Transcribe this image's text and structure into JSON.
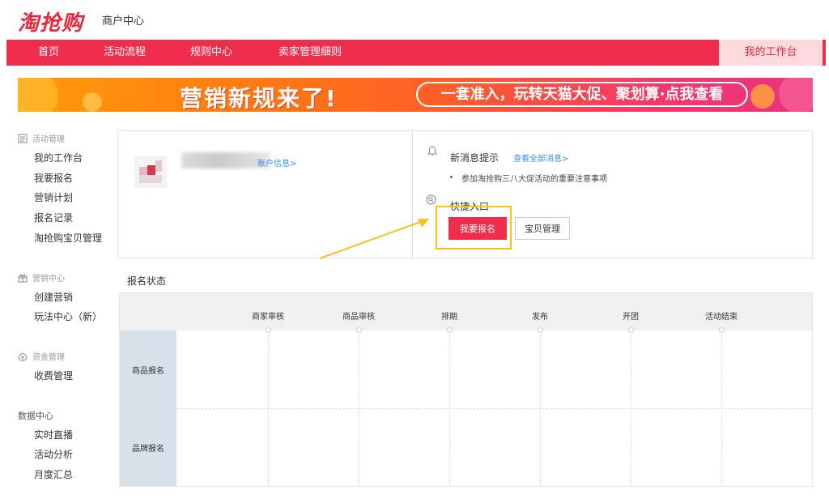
{
  "header": {
    "logo": "淘抢购",
    "subtitle": "商户中心"
  },
  "nav": {
    "items": [
      {
        "label": "首页"
      },
      {
        "label": "活动流程"
      },
      {
        "label": "规则中心"
      },
      {
        "label": "卖家管理细则"
      }
    ],
    "workbench": "我的工作台"
  },
  "banner": {
    "title": "营销新规来了!",
    "pill": "一套准入，玩转天猫大促、聚划算·点我查看"
  },
  "sidebar": {
    "groups": [
      {
        "title": "活动管理",
        "icon": "activity-icon",
        "items": [
          "我的工作台",
          "我要报名",
          "营销计划",
          "报名记录",
          "淘抢购宝贝管理"
        ]
      },
      {
        "title": "营销中心",
        "icon": "gift-icon",
        "items": [
          "创建营销",
          "玩法中心（新）"
        ]
      },
      {
        "title": "资金管理",
        "icon": "money-icon",
        "items": [
          "收费管理"
        ]
      },
      {
        "title": "数据中心",
        "icon": "",
        "items": [
          "实时直播",
          "活动分析",
          "月度汇总"
        ]
      }
    ]
  },
  "profile": {
    "account_link": "账户信息>"
  },
  "messages": {
    "title": "新消息提示",
    "view_all": "查看全部消息>",
    "items": [
      "参加淘抢购三八大促活动的重要注意事项"
    ]
  },
  "quick": {
    "title": "快捷入口",
    "signup_button": "我要报名",
    "manage_button": "宝贝管理"
  },
  "status": {
    "label": "报名状态",
    "columns": [
      "商家审核",
      "商品审核",
      "排期",
      "发布",
      "开团",
      "活动结束"
    ],
    "rows": [
      "商品报名",
      "品牌报名"
    ]
  },
  "colors": {
    "brand_red": "#ee2e4c",
    "highlight": "#f7c21f",
    "link_blue": "#3a8ee6"
  }
}
